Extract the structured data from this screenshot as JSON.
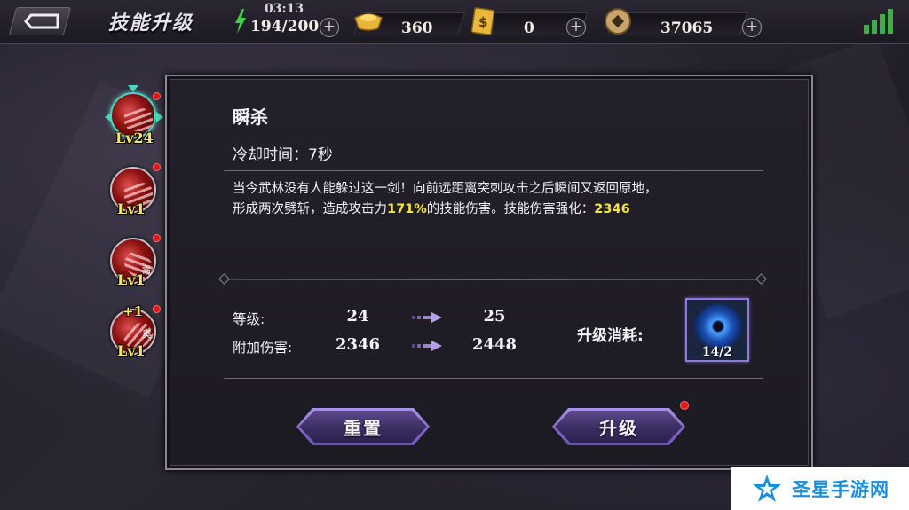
{
  "header": {
    "title": "技能升级",
    "timer": "03:13",
    "stamina": "194/200",
    "gold": "360",
    "tickets": "0",
    "coins": "37065"
  },
  "skills_sidebar": [
    {
      "level": "Lv24",
      "active": true
    },
    {
      "level": "Lv1",
      "active": false
    },
    {
      "level": "Lv1",
      "active": false,
      "tag": "需"
    },
    {
      "level": "Lv1",
      "active": false,
      "tag": "奥",
      "bonus": "+1"
    }
  ],
  "detail": {
    "name": "瞬杀",
    "cooldown": "冷却时间：7秒",
    "desc_line1": "当今武林没有人能躲过这一剑！向前远距离突刺攻击之后瞬间又返回原地，",
    "desc_line2_pre": "形成两次劈斩，造成攻击力",
    "desc_pct": "171%",
    "desc_line2_mid": "的技能伤害。技能伤害强化：",
    "desc_bonus": "2346",
    "stats": {
      "level_label": "等级:",
      "level_from": "24",
      "level_to": "25",
      "dmg_label": "附加伤害:",
      "dmg_from": "2346",
      "dmg_to": "2448"
    },
    "cost_label": "升级消耗:",
    "cost_count": "14/2",
    "reset_label": "重置",
    "upgrade_label": "升级"
  },
  "watermark": "圣星手游网",
  "colors": {
    "highlight": "#f5e63a",
    "accent_purple": "#6a52b8",
    "active_ring": "#4cd7c2",
    "notify": "#e01818"
  }
}
